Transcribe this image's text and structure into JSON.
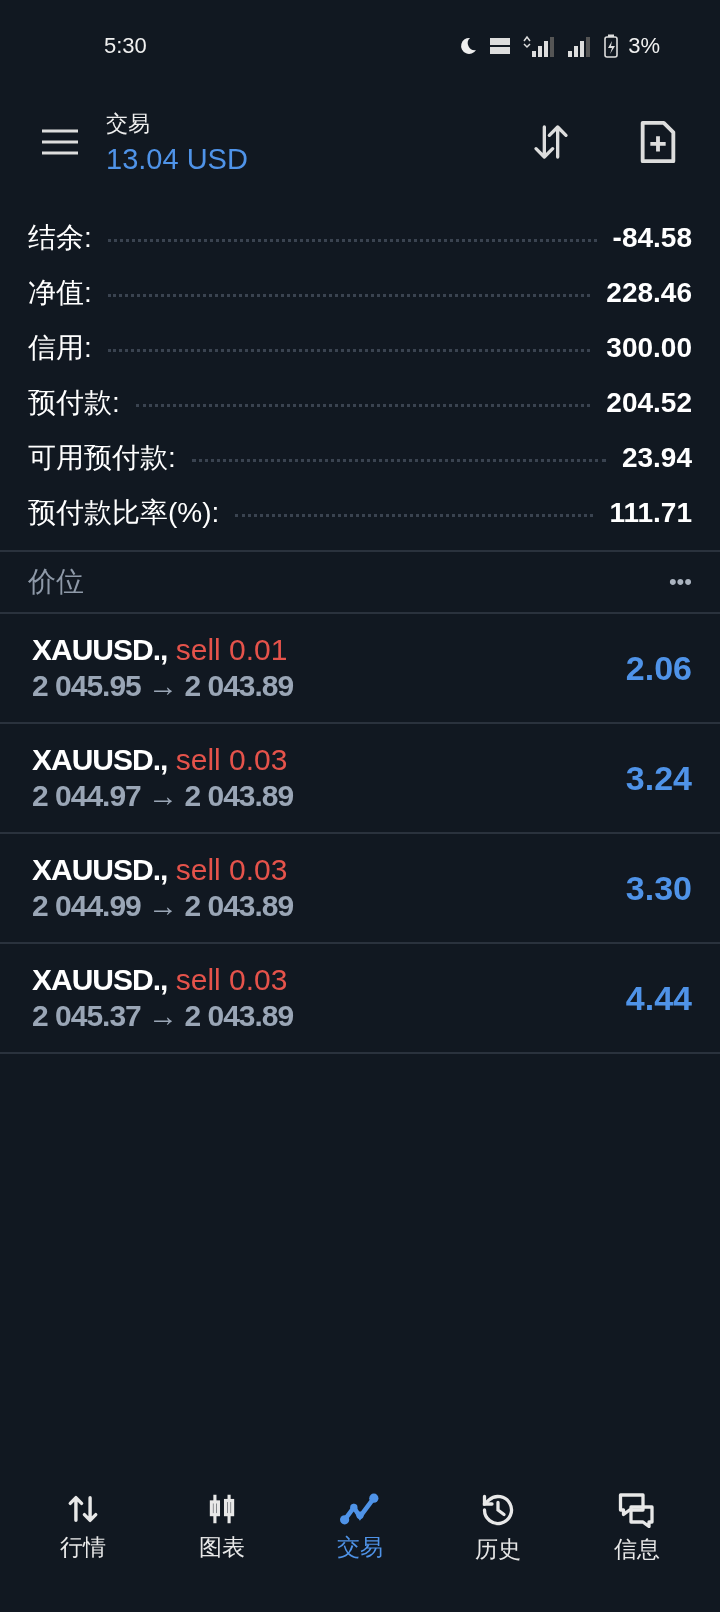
{
  "status_bar": {
    "time": "5:30",
    "battery": "3%"
  },
  "header": {
    "title": "交易",
    "balance": "13.04 USD"
  },
  "summary": [
    {
      "label": "结余:",
      "value": "-84.58"
    },
    {
      "label": "净值:",
      "value": "228.46"
    },
    {
      "label": "信用:",
      "value": "300.00"
    },
    {
      "label": "预付款:",
      "value": "204.52"
    },
    {
      "label": "可用预付款:",
      "value": "23.94"
    },
    {
      "label": "预付款比率(%):",
      "value": "111.71"
    }
  ],
  "positions_header": {
    "title": "价位",
    "menu": "•••"
  },
  "positions": [
    {
      "symbol": "XAUUSD.,",
      "order": "sell 0.01",
      "prices": "2 045.95 → 2 043.89",
      "profit": "2.06"
    },
    {
      "symbol": "XAUUSD.,",
      "order": "sell 0.03",
      "prices": "2 044.97 → 2 043.89",
      "profit": "3.24"
    },
    {
      "symbol": "XAUUSD.,",
      "order": "sell 0.03",
      "prices": "2 044.99 → 2 043.89",
      "profit": "3.30"
    },
    {
      "symbol": "XAUUSD.,",
      "order": "sell 0.03",
      "prices": "2 045.37 → 2 043.89",
      "profit": "4.44"
    }
  ],
  "nav": [
    {
      "label": "行情",
      "selected": false
    },
    {
      "label": "图表",
      "selected": false
    },
    {
      "label": "交易",
      "selected": true
    },
    {
      "label": "历史",
      "selected": false
    },
    {
      "label": "信息",
      "selected": false
    }
  ]
}
